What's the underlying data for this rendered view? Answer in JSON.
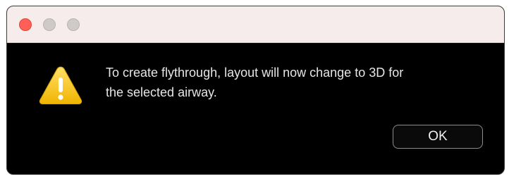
{
  "window": {
    "controls": [
      "close-button",
      "minimize-button",
      "zoom-button"
    ],
    "colors": {
      "close": "#ff5f57",
      "inactive": "#cfc9c9",
      "titlebar": "#f6ecec",
      "body": "#000000"
    }
  },
  "alert": {
    "icon": "warning-icon",
    "icon_color": "#f5c518",
    "message_line1": "To create flythrough, layout will now change to 3D for",
    "message_line2": "the selected airway.",
    "ok_label": "OK"
  }
}
